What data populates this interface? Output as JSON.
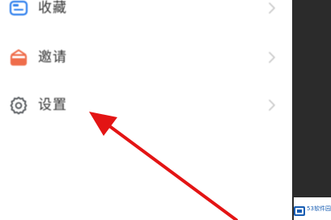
{
  "menu": {
    "items": [
      {
        "label": "收藏",
        "icon": "folder-icon"
      },
      {
        "label": "邀请",
        "icon": "gift-box-icon"
      },
      {
        "label": "设置",
        "icon": "gear-icon"
      }
    ]
  },
  "watermark": {
    "text": "53软件园"
  },
  "colors": {
    "accent_blue": "#2f80ed",
    "invite_orange": "#ef6d4b",
    "settings_gray": "#4f5357",
    "arrow_red": "#e31414",
    "chevron_gray": "#c8c8c8"
  }
}
